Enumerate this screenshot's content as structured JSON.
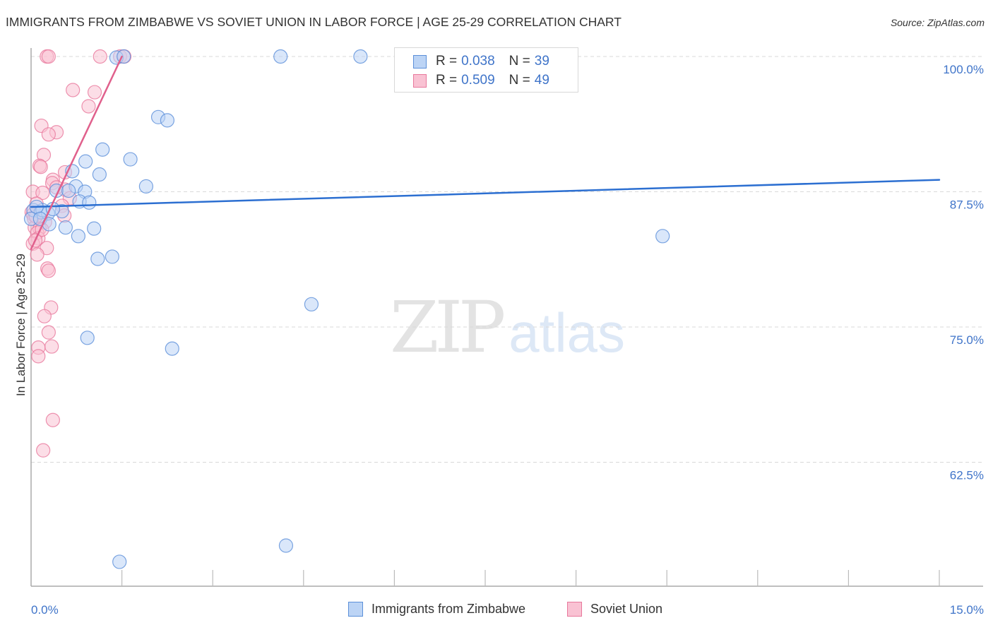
{
  "header": {
    "title": "IMMIGRANTS FROM ZIMBABWE VS SOVIET UNION IN LABOR FORCE | AGE 25-29 CORRELATION CHART",
    "source": "Source: ZipAtlas.com"
  },
  "watermark": {
    "zip": "ZIP",
    "atlas": "atlas"
  },
  "legend": {
    "rows": [
      {
        "r_label": "R =",
        "r_value": "0.038",
        "n_label": "N =",
        "n_value": "39"
      },
      {
        "r_label": "R =",
        "r_value": "0.509",
        "n_label": "N =",
        "n_value": "49"
      }
    ]
  },
  "bottom_legend": {
    "items": [
      {
        "label": "Immigrants from Zimbabwe"
      },
      {
        "label": "Soviet Union"
      }
    ]
  },
  "colors": {
    "blue_fill": "#bcd4f5",
    "blue_stroke": "#5b8fd9",
    "blue_line": "#2c6fd1",
    "pink_fill": "#f9c2d3",
    "pink_stroke": "#e8789c",
    "pink_line": "#e0608c",
    "tick_label": "#3f74c9",
    "grid": "#d9d9d9"
  },
  "chart_data": {
    "type": "scatter",
    "title": "IMMIGRANTS FROM ZIMBABWE VS SOVIET UNION IN LABOR FORCE | AGE 25-29 CORRELATION CHART",
    "xlabel": "",
    "ylabel": "In Labor Force | Age 25-29",
    "xlim": [
      0,
      15
    ],
    "ylim": [
      51.5,
      101.5
    ],
    "x_ticks": [
      0,
      1.5,
      3,
      4.5,
      6,
      7.5,
      9,
      10.5,
      12,
      13.5,
      15
    ],
    "x_tick_labels": [
      {
        "value": 0,
        "label": "0.0%"
      },
      {
        "value": 15,
        "label": "15.0%"
      }
    ],
    "y_ticks": [
      {
        "value": 100,
        "label": "100.0%"
      },
      {
        "value": 87.5,
        "label": "87.5%"
      },
      {
        "value": 75,
        "label": "75.0%"
      },
      {
        "value": 62.5,
        "label": "62.5%"
      }
    ],
    "grid": true,
    "legend_position": "top-center",
    "series": [
      {
        "name": "Immigrants from Zimbabwe",
        "R": 0.038,
        "N": 39,
        "trend": {
          "x": [
            0,
            15
          ],
          "y": [
            86.1,
            88.6
          ]
        },
        "points": [
          [
            1.41,
            99.9
          ],
          [
            1.53,
            100.0
          ],
          [
            4.12,
            100.0
          ],
          [
            5.44,
            100.0
          ],
          [
            2.1,
            94.4
          ],
          [
            2.25,
            94.1
          ],
          [
            1.18,
            91.4
          ],
          [
            0.9,
            90.3
          ],
          [
            1.64,
            90.5
          ],
          [
            0.68,
            89.4
          ],
          [
            1.13,
            89.1
          ],
          [
            1.9,
            88.0
          ],
          [
            0.74,
            88.0
          ],
          [
            0.42,
            87.6
          ],
          [
            0.62,
            87.6
          ],
          [
            0.89,
            87.5
          ],
          [
            0.8,
            86.6
          ],
          [
            0.96,
            86.5
          ],
          [
            0.04,
            85.8
          ],
          [
            0.16,
            85.6
          ],
          [
            0.28,
            85.5
          ],
          [
            0.19,
            85.8
          ],
          [
            0.51,
            85.7
          ],
          [
            0.09,
            86.1
          ],
          [
            0.0,
            85.0
          ],
          [
            0.36,
            85.9
          ],
          [
            0.15,
            85.0
          ],
          [
            0.3,
            84.5
          ],
          [
            0.57,
            84.2
          ],
          [
            1.04,
            84.1
          ],
          [
            0.78,
            83.4
          ],
          [
            1.1,
            81.3
          ],
          [
            1.34,
            81.5
          ],
          [
            10.43,
            83.4
          ],
          [
            4.63,
            77.1
          ],
          [
            0.93,
            74.0
          ],
          [
            2.33,
            73.0
          ],
          [
            4.21,
            54.8
          ],
          [
            1.46,
            53.3
          ]
        ]
      },
      {
        "name": "Soviet Union",
        "R": 0.509,
        "N": 49,
        "trend": {
          "x": [
            0,
            1.5
          ],
          "y": [
            82.2,
            100.0
          ]
        },
        "points": [
          [
            0.26,
            100.0
          ],
          [
            0.29,
            100.0
          ],
          [
            1.14,
            100.0
          ],
          [
            1.47,
            100.0
          ],
          [
            1.54,
            100.0
          ],
          [
            0.69,
            96.9
          ],
          [
            1.05,
            96.7
          ],
          [
            0.95,
            95.4
          ],
          [
            0.17,
            93.6
          ],
          [
            0.42,
            93.0
          ],
          [
            0.29,
            92.8
          ],
          [
            0.21,
            90.9
          ],
          [
            0.14,
            89.9
          ],
          [
            0.16,
            89.8
          ],
          [
            0.56,
            89.3
          ],
          [
            0.36,
            88.6
          ],
          [
            0.35,
            88.3
          ],
          [
            0.03,
            87.5
          ],
          [
            0.19,
            87.4
          ],
          [
            0.56,
            87.7
          ],
          [
            0.42,
            87.9
          ],
          [
            0.64,
            86.9
          ],
          [
            0.09,
            86.4
          ],
          [
            0.51,
            86.2
          ],
          [
            0.01,
            85.6
          ],
          [
            0.03,
            85.4
          ],
          [
            0.55,
            85.3
          ],
          [
            0.05,
            85.0
          ],
          [
            0.23,
            84.7
          ],
          [
            0.06,
            84.2
          ],
          [
            0.14,
            84.1
          ],
          [
            0.1,
            83.7
          ],
          [
            0.12,
            83.2
          ],
          [
            0.03,
            82.7
          ],
          [
            0.26,
            82.3
          ],
          [
            0.1,
            81.7
          ],
          [
            0.27,
            80.4
          ],
          [
            0.29,
            80.2
          ],
          [
            0.33,
            76.8
          ],
          [
            0.22,
            76.0
          ],
          [
            0.29,
            74.5
          ],
          [
            0.34,
            73.2
          ],
          [
            0.12,
            73.1
          ],
          [
            0.12,
            72.3
          ],
          [
            0.36,
            66.4
          ],
          [
            0.2,
            63.6
          ],
          [
            0.08,
            85.2
          ],
          [
            0.18,
            84.0
          ],
          [
            0.07,
            83.0
          ]
        ]
      }
    ]
  }
}
